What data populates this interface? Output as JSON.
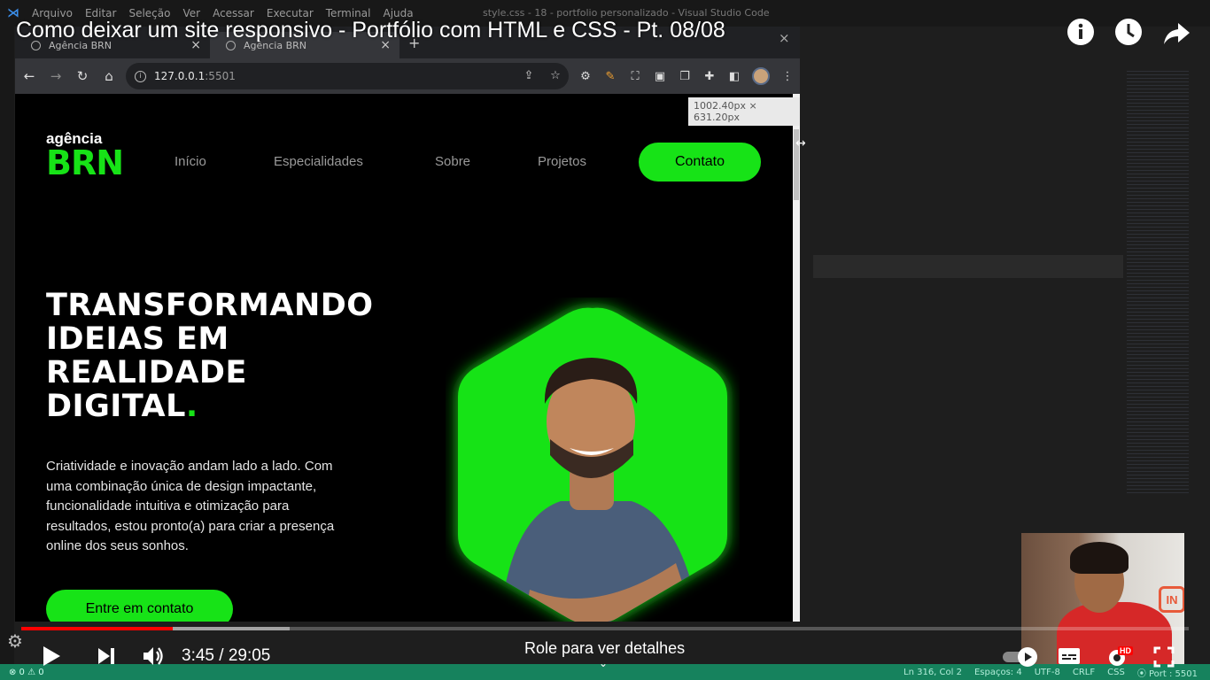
{
  "video": {
    "title": "Como deixar um site responsivo - Portfólio com HTML e CSS - Pt. 08/08",
    "time": "3:45 / 29:05",
    "scroll_hint": "Role para ver detalhes",
    "progress": {
      "played": 0.13,
      "buffered": 0.23
    },
    "hd_badge": "HD"
  },
  "vscode": {
    "menu": [
      "Arquivo",
      "Editar",
      "Seleção",
      "Ver",
      "Acessar",
      "Executar",
      "Terminal",
      "Ajuda"
    ],
    "window_title": "style.css - 18 - portfolio personalizado - Visual Studio Code",
    "status_left": "⊗ 0 ⚠ 0",
    "status": [
      "Ln 316, Col 2",
      "Espaços: 4",
      "UTF-8",
      "CRLF",
      "CSS",
      "⦿ Port : 5501"
    ]
  },
  "browser": {
    "tabs": [
      {
        "label": "Agência BRN"
      },
      {
        "label": "Agência BRN"
      }
    ],
    "url": "127.0.0.1",
    "port": ":5501",
    "size_tooltip": "1002.40px × 631.20px"
  },
  "site": {
    "brand_small": "agência",
    "brand_big": "BRN",
    "nav": [
      "Início",
      "Especialidades",
      "Sobre",
      "Projetos"
    ],
    "cta": "Contato",
    "hero_lines": [
      "TRANSFORMANDO",
      "IDEIAS EM",
      "REALIDADE",
      "DIGITAL"
    ],
    "hero_dot": ".",
    "hero_text": "Criatividade e inovação andam lado a lado. Com uma combinação única de design impactante, funcionalidade intuitiva e otimização para resultados, estou pronto(a) para criar a presença online dos seus sonhos.",
    "hero_button": "Entre em contato",
    "accent": "#17e317"
  },
  "webcam_logo": "IN"
}
